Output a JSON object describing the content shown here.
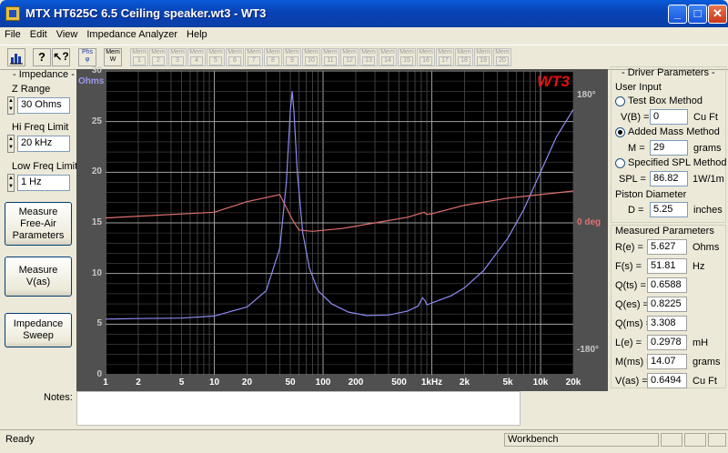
{
  "window": {
    "title": "MTX HT625C 6.5 Ceiling speaker.wt3 - WT3",
    "minimize": "_",
    "maximize": "□",
    "close": "✕"
  },
  "menu": [
    "File",
    "Edit",
    "View",
    "Impedance Analyzer",
    "Help"
  ],
  "toolbar": {
    "phase_label": "Phs",
    "mem_label": "Mem",
    "mem_w": "W",
    "mem_slots": [
      "1",
      "2",
      "3",
      "4",
      "5",
      "6",
      "7",
      "8",
      "9",
      "10",
      "11",
      "12",
      "13",
      "14",
      "15",
      "16",
      "17",
      "18",
      "19",
      "20"
    ]
  },
  "left": {
    "impedance_title": "Impedance",
    "z_range_label": "Z Range",
    "z_range_value": "30 Ohms",
    "hi_freq_label": "Hi Freq Limit",
    "hi_freq_value": "20 kHz",
    "low_freq_label": "Low Freq Limit",
    "low_freq_value": "1 Hz",
    "btn_free_air": "Measure Free-Air Parameters",
    "btn_vas": "Measure V(as)",
    "btn_sweep": "Impedance Sweep"
  },
  "chart_data": {
    "type": "line",
    "watermark": "WT3",
    "y_unit": "Ohms",
    "x_scale": "log",
    "xlim": [
      1,
      20000
    ],
    "ylim": [
      0,
      30
    ],
    "y_ticks": [
      0,
      5,
      10,
      15,
      20,
      25,
      30
    ],
    "x_ticks": [
      {
        "v": 1,
        "label": "1"
      },
      {
        "v": 2,
        "label": "2"
      },
      {
        "v": 5,
        "label": "5"
      },
      {
        "v": 10,
        "label": "10"
      },
      {
        "v": 20,
        "label": "20"
      },
      {
        "v": 50,
        "label": "50"
      },
      {
        "v": 100,
        "label": "100"
      },
      {
        "v": 200,
        "label": "200"
      },
      {
        "v": 500,
        "label": "500"
      },
      {
        "v": 1000,
        "label": "1kHz"
      },
      {
        "v": 2000,
        "label": "2k"
      },
      {
        "v": 5000,
        "label": "5k"
      },
      {
        "v": 10000,
        "label": "10k"
      },
      {
        "v": 20000,
        "label": "20k"
      }
    ],
    "phase_ticks": [
      {
        "label": "180°",
        "v": 180
      },
      {
        "label": "0 deg",
        "v": 0
      },
      {
        "label": "-180°",
        "v": -180
      }
    ],
    "grid": true,
    "series": [
      {
        "role": "impedance",
        "color": "#8c8cf0",
        "points": [
          [
            1,
            5.5
          ],
          [
            2,
            5.55
          ],
          [
            5,
            5.6
          ],
          [
            10,
            5.8
          ],
          [
            20,
            6.7
          ],
          [
            30,
            8.3
          ],
          [
            40,
            12.5
          ],
          [
            46,
            19
          ],
          [
            50,
            26
          ],
          [
            52,
            28
          ],
          [
            54,
            26
          ],
          [
            58,
            20
          ],
          [
            65,
            14
          ],
          [
            75,
            10.5
          ],
          [
            90,
            8.3
          ],
          [
            120,
            7
          ],
          [
            170,
            6.2
          ],
          [
            250,
            5.85
          ],
          [
            400,
            5.9
          ],
          [
            600,
            6.3
          ],
          [
            750,
            6.8
          ],
          [
            820,
            7.6
          ],
          [
            870,
            7.3
          ],
          [
            900,
            6.9
          ],
          [
            1000,
            7.1
          ],
          [
            1500,
            7.8
          ],
          [
            2000,
            8.6
          ],
          [
            3000,
            10.3
          ],
          [
            5000,
            13.5
          ],
          [
            7000,
            16.3
          ],
          [
            10000,
            20
          ],
          [
            14000,
            23.5
          ],
          [
            20000,
            26.2
          ]
        ]
      },
      {
        "role": "phase",
        "color": "#e07070",
        "points": [
          [
            1,
            7
          ],
          [
            10,
            15
          ],
          [
            20,
            30
          ],
          [
            40,
            40
          ],
          [
            52,
            5
          ],
          [
            60,
            -10
          ],
          [
            80,
            -12
          ],
          [
            150,
            -8
          ],
          [
            300,
            0
          ],
          [
            600,
            8
          ],
          [
            850,
            15
          ],
          [
            900,
            12
          ],
          [
            1000,
            13
          ],
          [
            2000,
            25
          ],
          [
            5000,
            35
          ],
          [
            10000,
            40
          ],
          [
            20000,
            45
          ]
        ]
      }
    ]
  },
  "right": {
    "driver_title": "Driver Parameters",
    "user_input_title": "User Input",
    "opt_test_box": "Test Box Method",
    "vb_label": "V(B) =",
    "vb_value": "0",
    "vb_unit": "Cu Ft",
    "opt_added_mass": "Added Mass Method",
    "m_label": "M =",
    "m_value": "29",
    "m_unit": "grams",
    "opt_spl": "Specified SPL Method",
    "spl_label": "SPL =",
    "spl_value": "86.82",
    "spl_unit": "1W/1m",
    "piston_label": "Piston Diameter",
    "d_label": "D =",
    "d_value": "5.25",
    "d_unit": "inches",
    "measured_title": "Measured Parameters",
    "measured": [
      {
        "label": "R(e) =",
        "value": "5.627",
        "unit": "Ohms"
      },
      {
        "label": "F(s) =",
        "value": "51.81",
        "unit": "Hz"
      },
      {
        "label": "Q(ts) =",
        "value": "0.6588",
        "unit": ""
      },
      {
        "label": "Q(es) =",
        "value": "0.8225",
        "unit": ""
      },
      {
        "label": "Q(ms) =",
        "value": "3.308",
        "unit": ""
      },
      {
        "label": "L(e) =",
        "value": "0.2978",
        "unit": "mH"
      },
      {
        "label": "M(ms) =",
        "value": "14.07",
        "unit": "grams"
      },
      {
        "label": "V(as) =",
        "value": "0.6494",
        "unit": "Cu Ft"
      }
    ]
  },
  "notes_label": "Notes:",
  "status": {
    "ready": "Ready",
    "mode": "Workbench"
  }
}
